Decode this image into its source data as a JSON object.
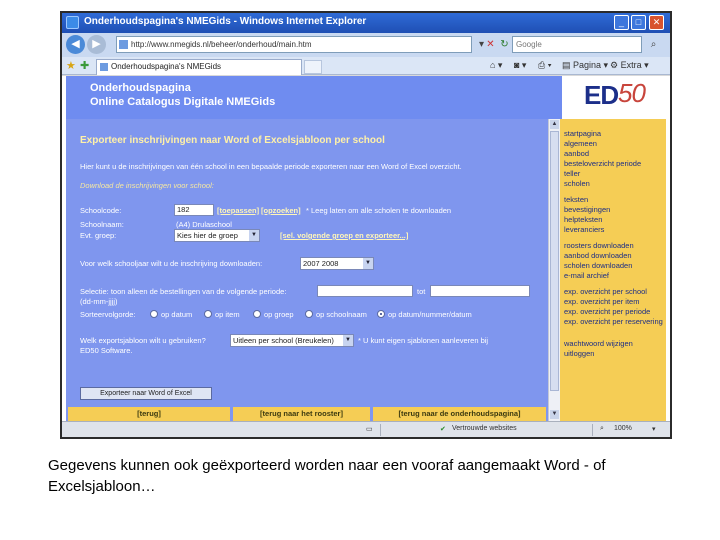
{
  "window": {
    "title": "Onderhoudspagina's NMEGids - Windows Internet Explorer",
    "minimize_icon": "minimize-icon",
    "maximize_icon": "maximize-icon",
    "close_icon": "close-icon"
  },
  "browser": {
    "url": "http://www.nmegids.nl/beheer/onderhoud/main.htm",
    "search_placeholder": "Google",
    "tab_label": "Onderhoudspagina's NMEGids",
    "cmd_page": "Pagina",
    "cmd_extra": "Extra"
  },
  "banner": {
    "line1": "Onderhoudspagina",
    "line2": "Online Catalogus Digitale NMEGids",
    "logo_ed": "ED",
    "logo_50": "50"
  },
  "form": {
    "heading": "Exporteer inschrijvingen naar Word of Excelsjabloon per school",
    "intro": "Hier kunt u de inschrijvingen van één school in een bepaalde periode exporteren naar een Word of Excel overzicht.",
    "subheading": "Download de inschrijvingen voor school:",
    "schoolcode_label": "Schoolcode:",
    "schoolcode_value": "182",
    "btn_toepassen": "[toepassen]",
    "btn_opzoeken": "[opzoeken]",
    "schoolcode_hint": "* Leeg laten om alle scholen te downloaden",
    "schoolnaam_label": "Schoolnaam:",
    "schoolnaam_value": "(A4) Drulaschool",
    "groep_label": "Evt. groep:",
    "groep_value": "Kies hier de groep",
    "groep_link": "[sel. volgende groep en exporteer...]",
    "jaar_label": "Voor welk schooljaar wilt u de inschrijving downloaden:",
    "jaar_value": "2007 2008",
    "periode_label": "Selectie: toon alleen de bestellingen van de volgende periode:",
    "periode_tot": "tot",
    "periode_format": "(dd-mm-jjjj)",
    "sort_label": "Sorteervolgorde:",
    "sort_options": [
      "op datum",
      "op item",
      "op groep",
      "op schoolnaam",
      "op datum/nummer/datum"
    ],
    "sjabloon_label": "Welk exportsjabloon wilt u gebruiken?",
    "sjabloon_value": "Uitleen per school (Breukelen)",
    "sjabloon_hint": "* U kunt eigen sjablonen aanleveren bij",
    "sjabloon_hint2": "ED50 Software.",
    "export_button": "Exporteer naar Word of Excel"
  },
  "footer_links": [
    "[terug]",
    "[terug naar het rooster]",
    "[terug naar de onderhoudspagina]"
  ],
  "sidebar": {
    "items": [
      "startpagina",
      "algemeen",
      "aanbod",
      "besteloverzicht periode",
      "teller",
      "scholen",
      "teksten",
      "bevestigingen",
      "helpteksten",
      "leveranciers",
      "roosters downloaden",
      "aanbod downloaden",
      "scholen downloaden",
      "e-mail archief",
      "exp. overzicht per school",
      "exp. overzicht per item",
      "exp. overzicht per periode",
      "exp. overzicht per reservering",
      "wachtwoord wijzigen",
      "uitloggen"
    ]
  },
  "status": {
    "zone": "Vertrouwde websites",
    "zoom": "100%"
  },
  "caption": "Gegevens kunnen ook geëxporteerd worden naar een vooraf aangemaakt Word - of Excelsjabloon…"
}
